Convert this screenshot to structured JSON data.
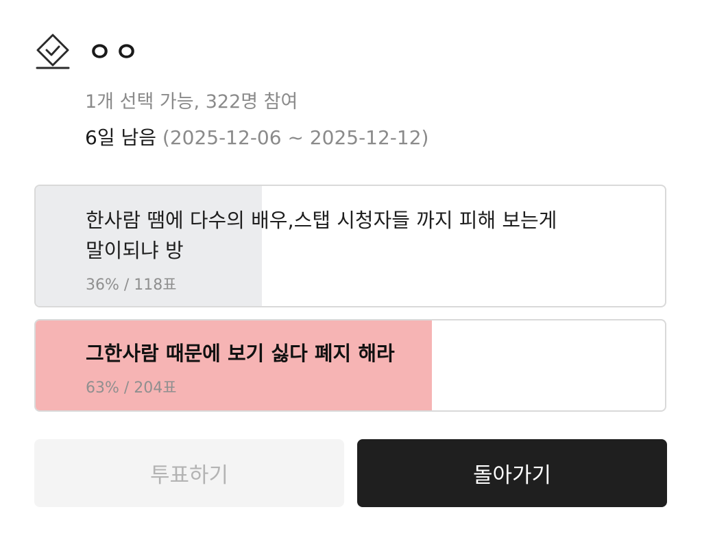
{
  "poll": {
    "title": "ㅇㅇ",
    "meta": "1개 선택 가능, 322명 참여",
    "remaining": "6일 남음",
    "date_range": " (2025-12-06 ~ 2025-12-12)",
    "icon": "vote-box-check-icon",
    "options": [
      {
        "text": "한사람 땜에 다수의 배우,스탭 시청자들 까지 피해 보는게 말이되냐 방",
        "stats": "36% / 118표",
        "percent": 36,
        "selected": false,
        "fill_color": "#ebecee"
      },
      {
        "text": "그한사람 때문에 보기 싫다 폐지 해라",
        "stats": "63% / 204표",
        "percent": 63,
        "selected": true,
        "fill_color": "#f6b4b4"
      }
    ]
  },
  "buttons": {
    "vote_label": "투표하기",
    "back_label": "돌아가기"
  },
  "colors": {
    "selected_fill": "#f6b4b4",
    "unselected_fill": "#ebecee",
    "back_button": "#1f1f1f",
    "vote_button_disabled": "#f4f4f4"
  }
}
